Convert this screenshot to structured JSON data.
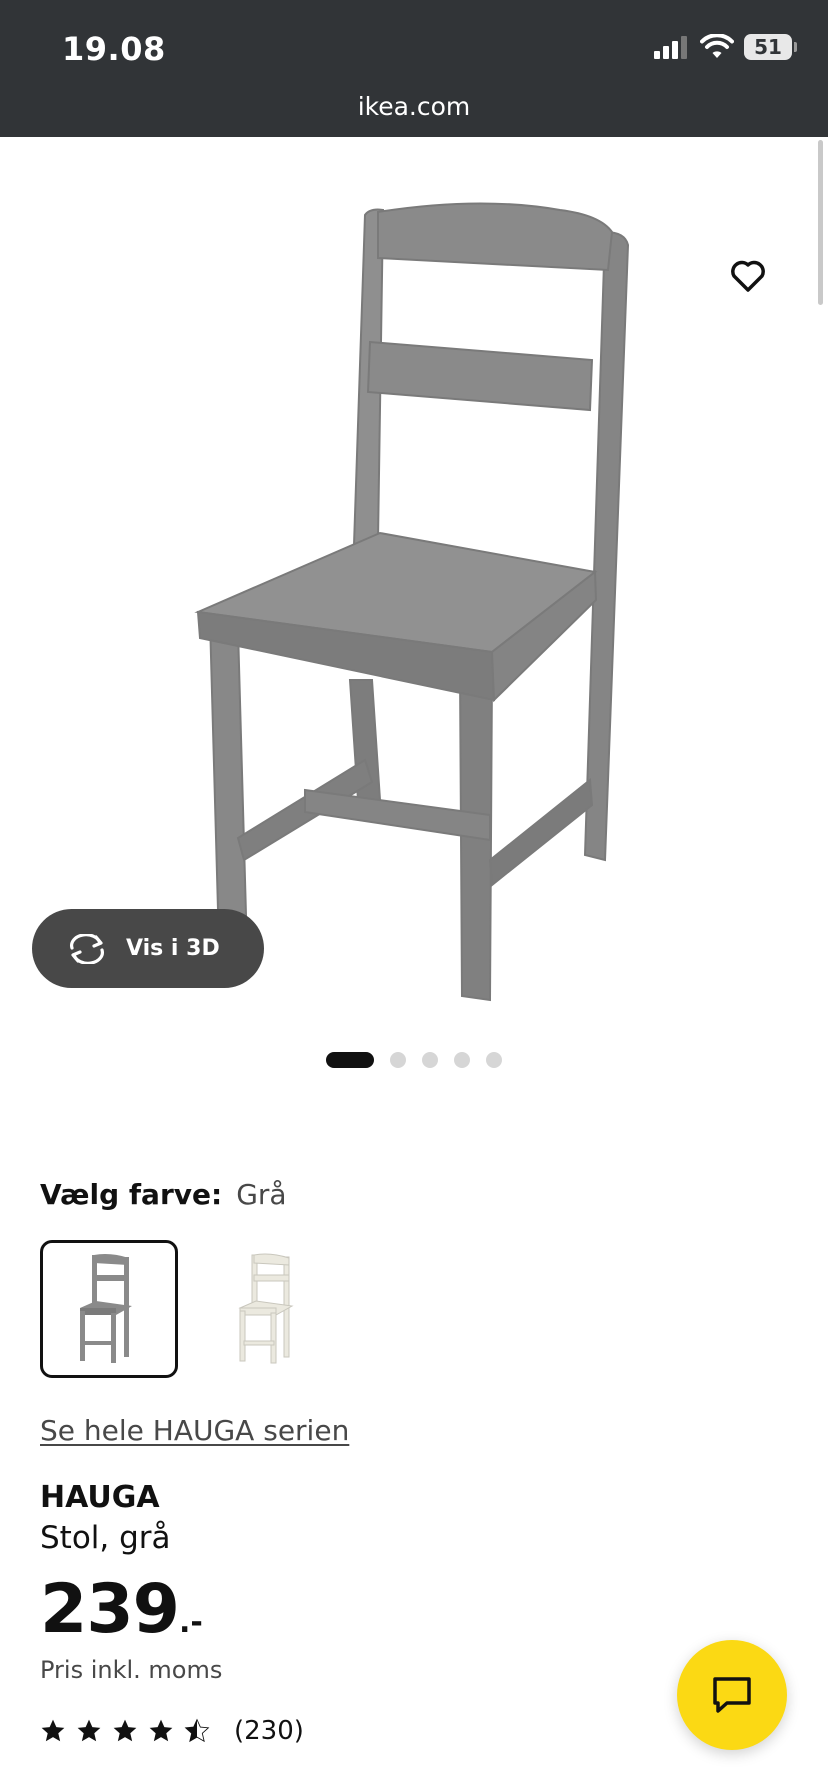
{
  "status_bar": {
    "time": "19.08",
    "battery": "51"
  },
  "browser": {
    "url": "ikea.com"
  },
  "gallery": {
    "view_3d_label": "Vis i 3D",
    "slide_count": 5,
    "active_slide": 1
  },
  "color_picker": {
    "label": "Vælg farve:",
    "selected_value": "Grå",
    "options": [
      {
        "name": "grey-chair",
        "color": "#8a8a8a"
      },
      {
        "name": "white-chair",
        "color": "#e9e8df"
      }
    ]
  },
  "series_link": "Se hele HAUGA serien",
  "product": {
    "name": "HAUGA",
    "description": "Stol, grå",
    "price_main": "239",
    "price_suffix": ".-",
    "price_note": "Pris inkl. moms",
    "rating": 4.5,
    "review_count": "(230)"
  },
  "colors": {
    "status_bar_bg": "#313437",
    "chair_grey": "#8a8a8a",
    "chat_button": "#fbd914",
    "button_3d_bg": "#484848"
  },
  "icons": [
    "wifi-icon",
    "signal-icon",
    "battery-icon",
    "heart-icon",
    "rotate-3d-icon",
    "star-icon",
    "chat-icon"
  ]
}
